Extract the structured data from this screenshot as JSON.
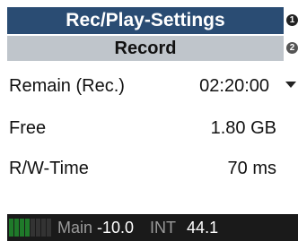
{
  "header": {
    "title": "Rec/Play-Settings",
    "subtitle": "Record",
    "page_icon_1": "1",
    "page_icon_2": "2"
  },
  "settings": [
    {
      "label": "Remain (Rec.)",
      "value": "02:20:00",
      "has_dropdown": true
    },
    {
      "label": "Free",
      "value": "1.80 GB",
      "has_dropdown": false
    },
    {
      "label": "R/W-Time",
      "value": "70 ms",
      "has_dropdown": false
    }
  ],
  "status_bar": {
    "meter_level_fraction": 0.5,
    "channel_label": "Main",
    "channel_value": "-10.0",
    "clock_label": "INT",
    "clock_value": "44.1"
  },
  "colors": {
    "title_bg": "#2a4c73",
    "subtitle_bg": "#bfc5cb",
    "status_bg": "#1a1a1a",
    "meter_on": "#1f7a2a"
  }
}
